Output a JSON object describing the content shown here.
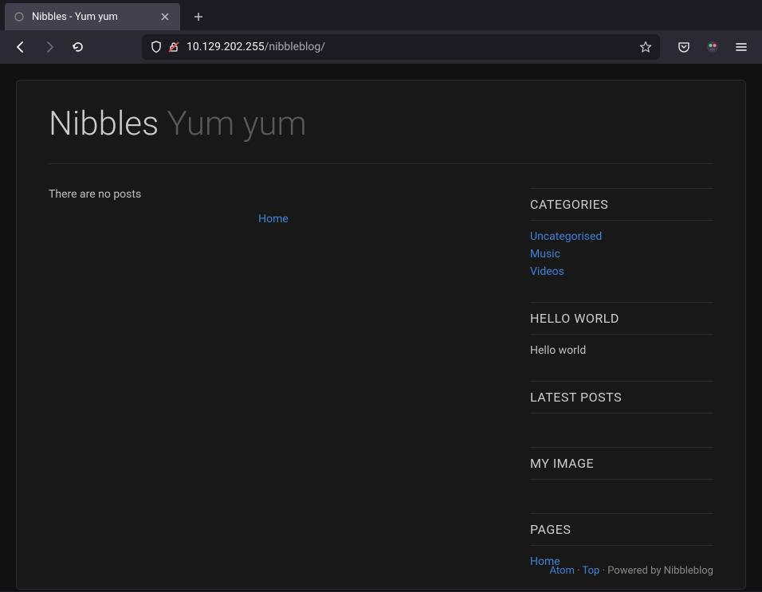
{
  "browser": {
    "tab_title": "Nibbles - Yum yum",
    "url_host": "10.129.202.255",
    "url_path": "/nibbleblog/"
  },
  "blog": {
    "title": "Nibbles",
    "subtitle": "Yum yum",
    "no_posts_text": "There are no posts",
    "home_link": "Home"
  },
  "widgets": {
    "categories": {
      "title": "CATEGORIES",
      "items": [
        "Uncategorised",
        "Music",
        "Videos"
      ]
    },
    "hello": {
      "title": "HELLO WORLD",
      "text": "Hello world"
    },
    "latest": {
      "title": "LATEST POSTS"
    },
    "myimage": {
      "title": "MY IMAGE"
    },
    "pages": {
      "title": "PAGES",
      "items": [
        "Home"
      ]
    }
  },
  "footer": {
    "atom": "Atom",
    "top": "Top",
    "powered": "Powered by Nibbleblog"
  }
}
